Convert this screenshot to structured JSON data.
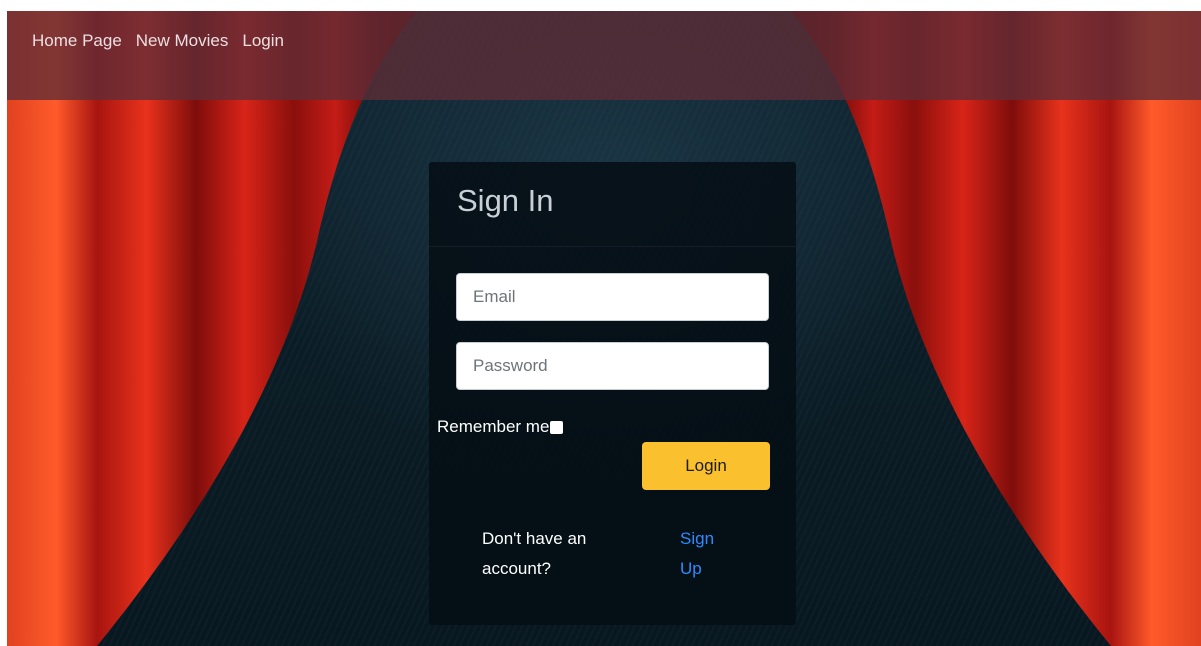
{
  "nav": {
    "items": [
      {
        "label": "Home Page"
      },
      {
        "label": "New Movies"
      },
      {
        "label": "Login"
      }
    ]
  },
  "signin": {
    "title": "Sign In",
    "email_placeholder": "Email",
    "password_placeholder": "Password",
    "remember_label": "Remember me",
    "login_label": "Login",
    "no_account_text": "Don't have an account?",
    "signup_label": "Sign Up"
  },
  "colors": {
    "accent": "#fbc02d",
    "link": "#2e8bff",
    "curtain": "#c4201a"
  }
}
